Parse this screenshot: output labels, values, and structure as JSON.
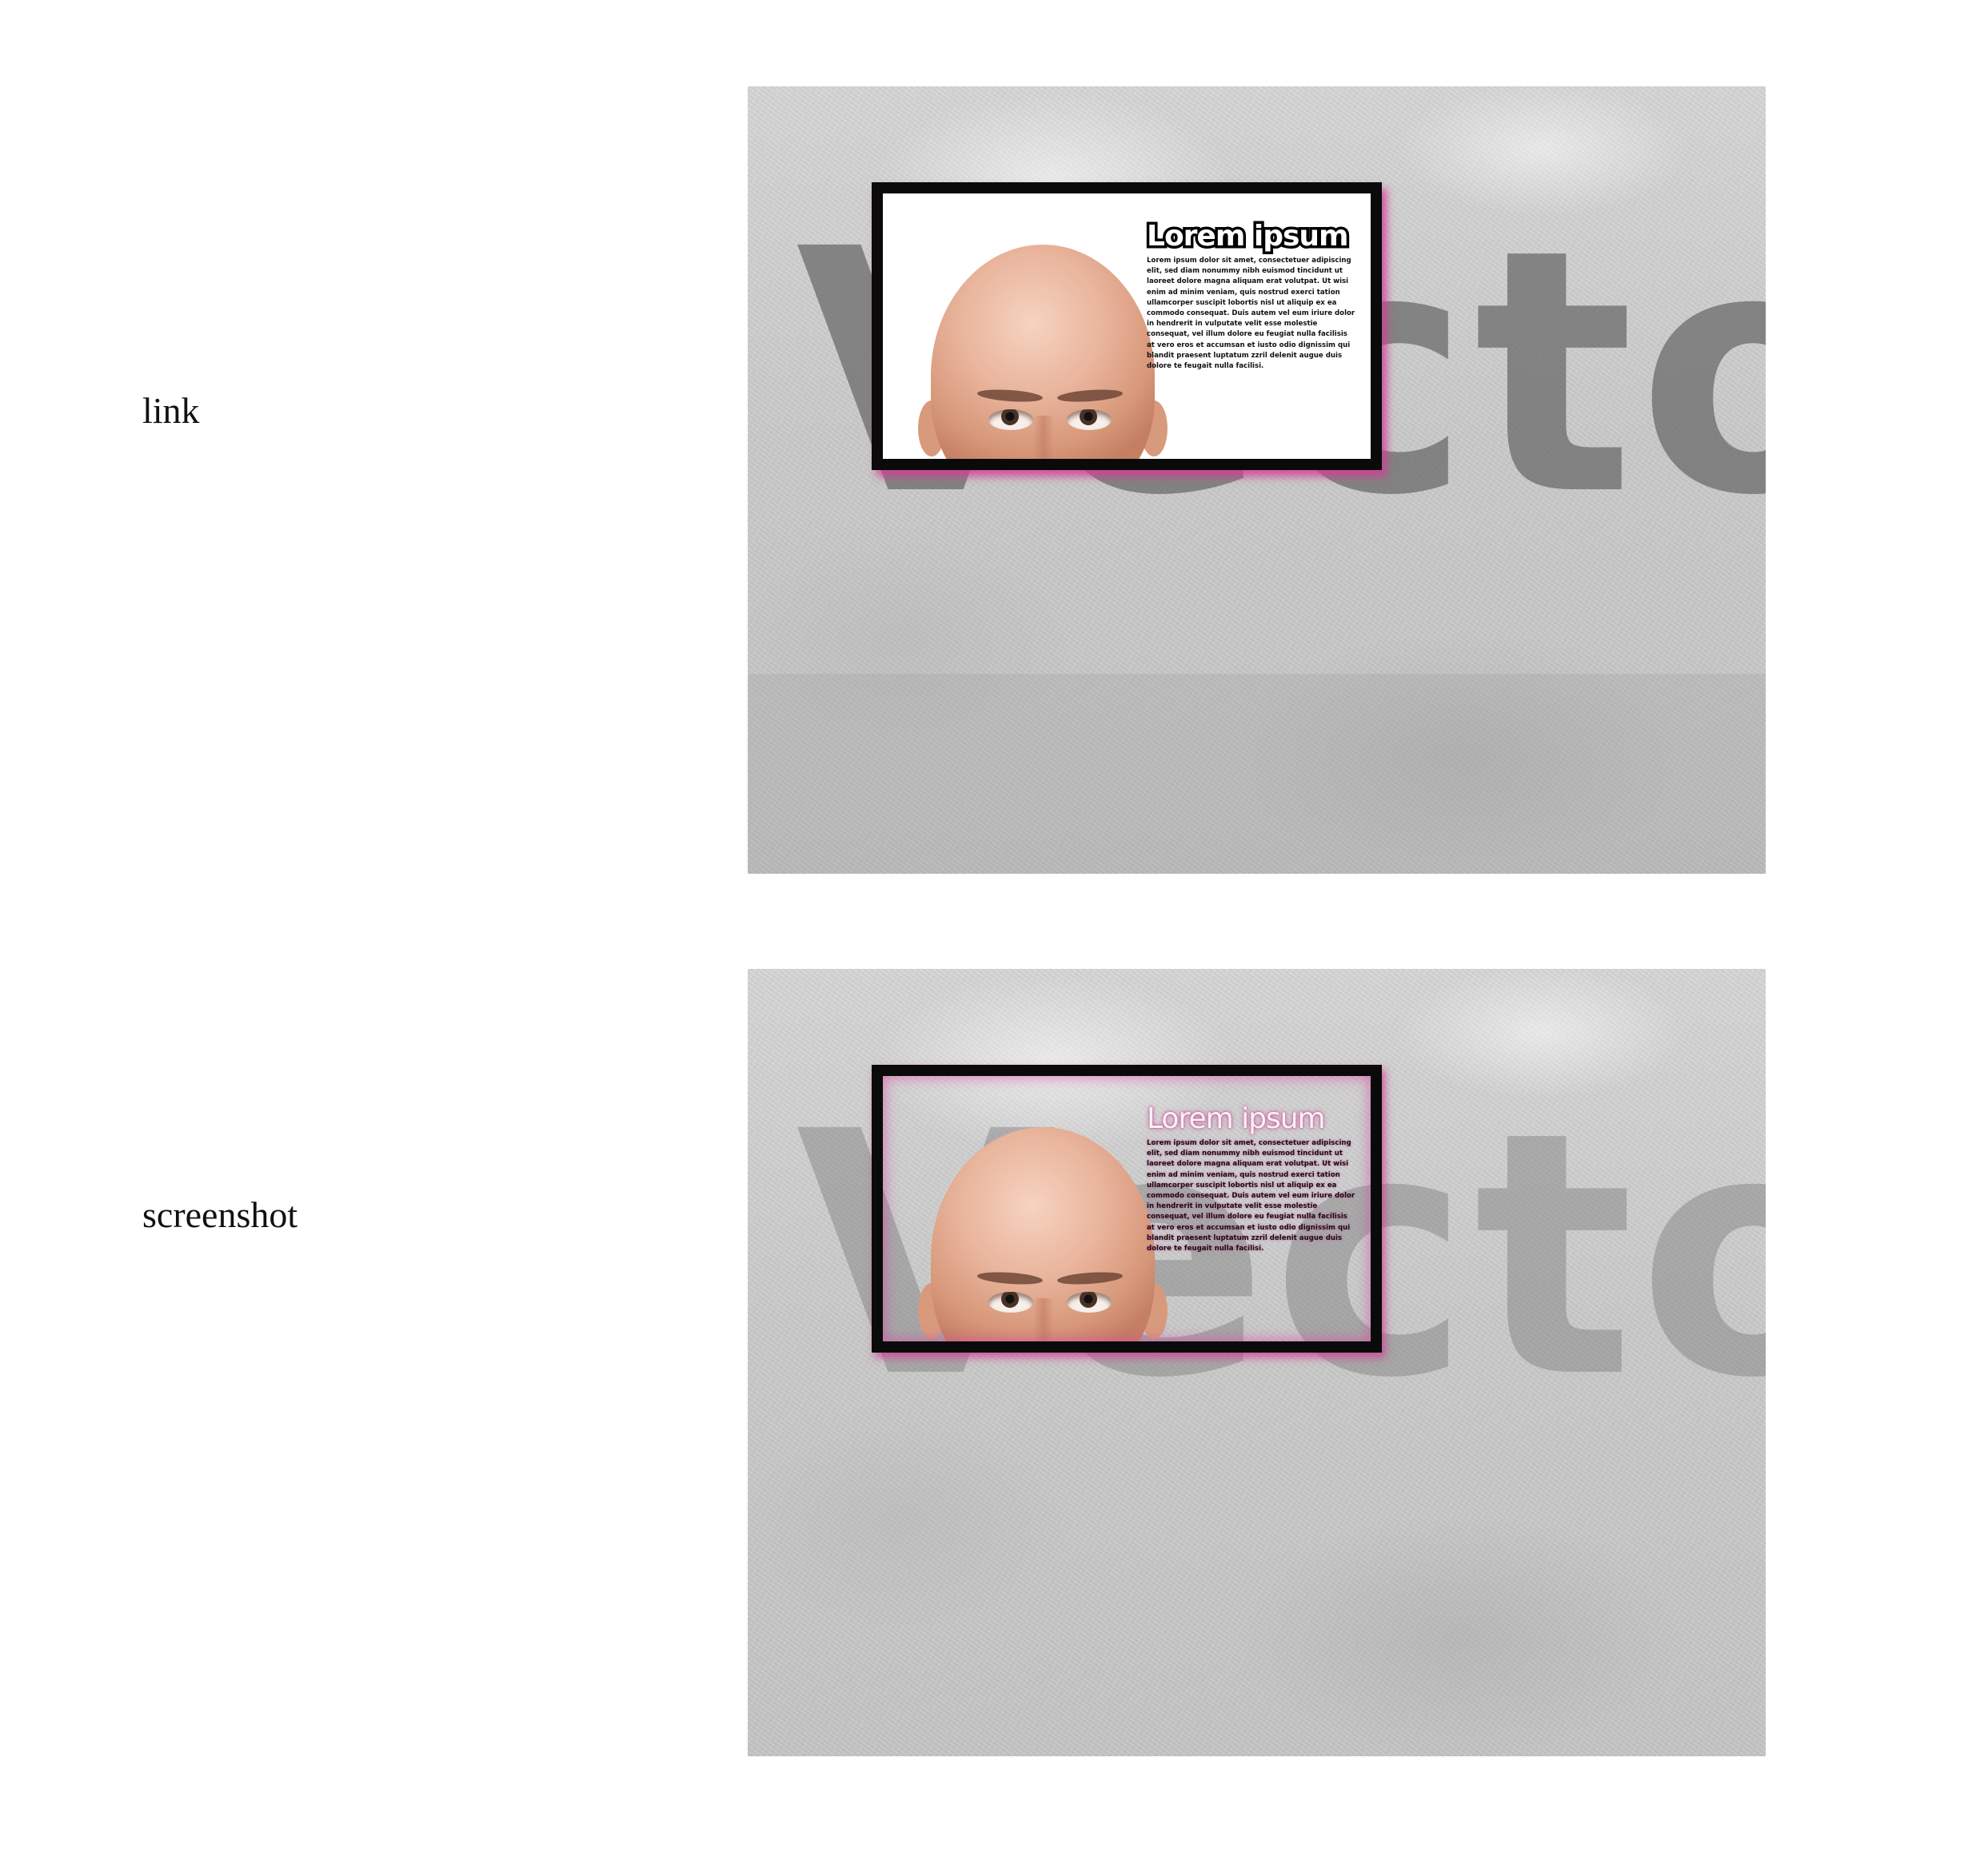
{
  "rows": [
    {
      "label": "link",
      "mockup": {
        "watermark": "Vector",
        "headline": "Lorem ipsum",
        "body": "Lorem ipsum dolor sit amet, consectetuer adipiscing elit, sed diam nonummy nibh euismod tincidunt ut laoreet dolore magna aliquam erat volutpat. Ut wisi enim ad minim veniam, quis nostrud exerci tation ullamcorper suscipit lobortis nisl ut aliquip ex ea commodo consequat. Duis autem vel eum iriure dolor in hendrerit in vulputate velit esse molestie consequat, vel illum dolore eu feugiat nulla facilisis at vero eros et accumsan et iusto odio dignissim qui blandit praesent luptatum zzril delenit augue duis dolore te feugait nulla facilisi."
      }
    },
    {
      "label": "screenshot",
      "mockup": {
        "watermark": "Vector",
        "headline": "Lorem ipsum",
        "body": "Lorem ipsum dolor sit amet, consectetuer adipiscing elit, sed diam nonummy nibh euismod tincidunt ut laoreet dolore magna aliquam erat volutpat. Ut wisi enim ad minim veniam, quis nostrud exerci tation ullamcorper suscipit lobortis nisl ut aliquip ex ea commodo consequat. Duis autem vel eum iriure dolor in hendrerit in vulputate velit esse molestie consequat, vel illum dolore eu feugiat nulla facilisis at vero eros et accumsan et iusto odio dignissim qui blandit praesent luptatum zzril delenit augue duis dolore te feugait nulla facilisi."
      }
    }
  ],
  "colors": {
    "frame": "#0a0a0a",
    "glow": "#d23c96",
    "panel_gray": "#cdcdcd"
  }
}
